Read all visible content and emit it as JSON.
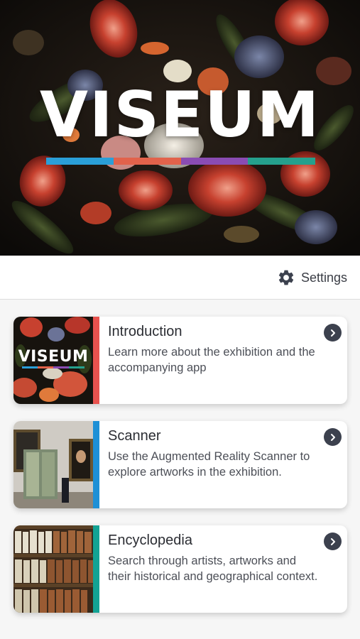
{
  "hero": {
    "logo": "VISEUM",
    "stripe_colors": [
      "#2a9fd8",
      "#e2624b",
      "#8a4cb3",
      "#25a08d"
    ]
  },
  "settings": {
    "label": "Settings",
    "icon": "gear-icon"
  },
  "cards": [
    {
      "title": "Introduction",
      "description": "Learn more about the exhibition and the accompanying app",
      "accent": "#e8524e",
      "thumb_logo": "VISEUM",
      "icon": "chevron-right-icon"
    },
    {
      "title": "Scanner",
      "description": "Use the Augmented Reality Scanner to explore artworks in the exhibition.",
      "accent": "#1e90d6",
      "icon": "chevron-right-icon"
    },
    {
      "title": "Encyclopedia",
      "description": "Search through artists, artworks and their historical and geographical context.",
      "accent": "#13a394",
      "icon": "chevron-right-icon"
    }
  ]
}
